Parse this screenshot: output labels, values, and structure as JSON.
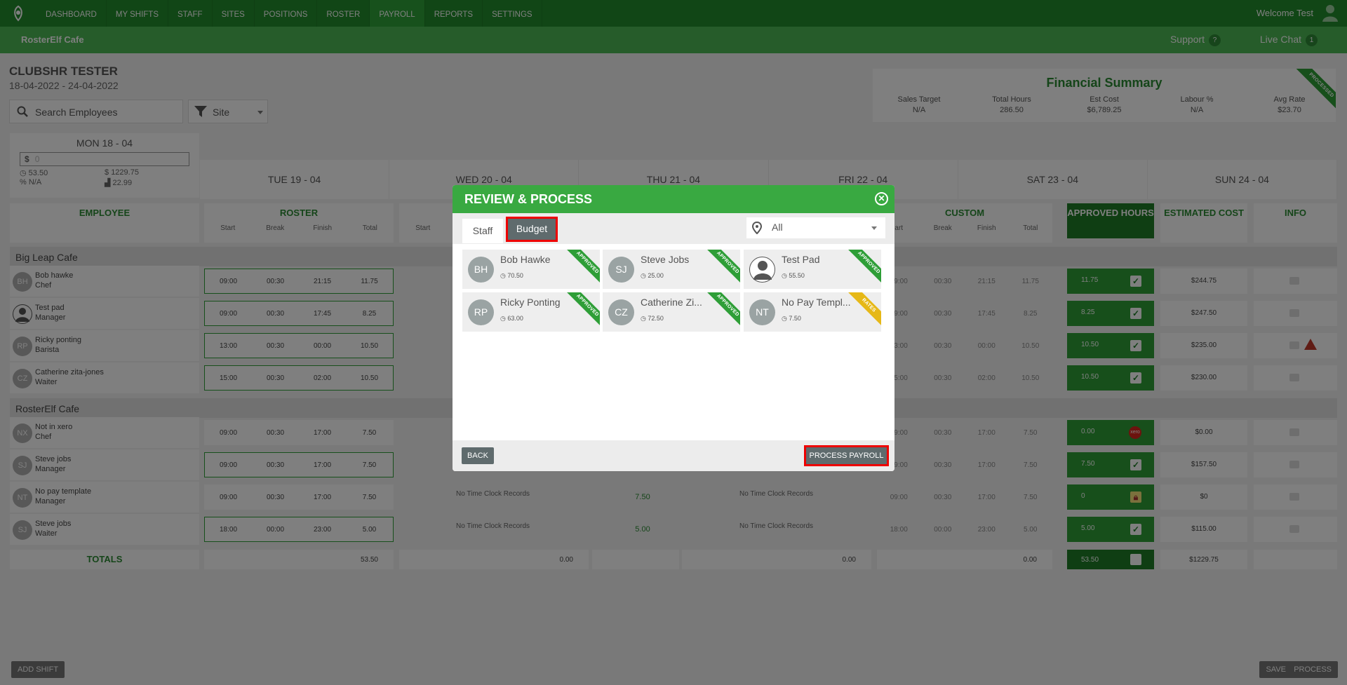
{
  "nav": {
    "items": [
      {
        "label": "DASHBOARD"
      },
      {
        "label": "MY SHIFTS"
      },
      {
        "label": "STAFF"
      },
      {
        "label": "SITES"
      },
      {
        "label": "POSITIONS"
      },
      {
        "label": "ROSTER"
      },
      {
        "label": "PAYROLL"
      },
      {
        "label": "REPORTS"
      },
      {
        "label": "SETTINGS"
      }
    ],
    "active": "PAYROLL",
    "welcome": "Welcome Test"
  },
  "subbar": {
    "cafe_name": "RosterElf Cafe",
    "support": "Support",
    "support_badge": "?",
    "live_chat": "Live Chat",
    "live_chat_badge": "1"
  },
  "page": {
    "title": "CLUBSHR TESTER",
    "dates": "18-04-2022 - 24-04-2022",
    "search_placeholder": "Search Employees",
    "site_filter": "Site"
  },
  "financial_summary": {
    "title": "Financial Summary",
    "ribbon": "PROCESSED",
    "cols": [
      {
        "label": "Sales Target",
        "value": "N/A"
      },
      {
        "label": "Total Hours",
        "value": "286.50"
      },
      {
        "label": "Est Cost",
        "value": "$6,789.25"
      },
      {
        "label": "Labour %",
        "value": "N/A"
      },
      {
        "label": "Avg Rate",
        "value": "$23.70"
      }
    ]
  },
  "monday": {
    "title": "MON 18 - 04",
    "currency": "$",
    "input_value": "0",
    "hours": "53.50",
    "cost": "1229.75",
    "pct": "N/A",
    "rate": "22.99"
  },
  "days": [
    "TUE 19 - 04",
    "WED 20 - 04",
    "THU 21 - 04",
    "FRI 22 - 04",
    "SAT 23 - 04",
    "SUN 24 - 04"
  ],
  "headers": {
    "employee": "EMPLOYEE",
    "roster": "ROSTER",
    "custom": "CUSTOM",
    "approved": "APPROVED HOURS",
    "estimated": "ESTIMATED COST",
    "info": "INFO",
    "start": "Start",
    "break": "Break",
    "finish": "Finish",
    "total": "Total",
    "start_trunc": "art"
  },
  "sections": [
    "Big Leap Cafe",
    "RosterElf Cafe"
  ],
  "rows": [
    {
      "initials": "BH",
      "name": "Bob hawke",
      "role": "Chef",
      "start": "09:00",
      "break": "00:30",
      "finish": "21:15",
      "total": "11.75",
      "approved": "11.75",
      "est": "$244.75"
    },
    {
      "initials": "",
      "name": "Test pad",
      "role": "Manager",
      "start": "09:00",
      "break": "00:30",
      "finish": "17:45",
      "total": "8.25",
      "approved": "8.25",
      "est": "$247.50"
    },
    {
      "initials": "RP",
      "name": "Ricky ponting",
      "role": "Barista",
      "start": "13:00",
      "break": "00:30",
      "finish": "00:00",
      "total": "10.50",
      "approved": "10.50",
      "est": "$235.00"
    },
    {
      "initials": "CZ",
      "name": "Catherine zita-jones",
      "role": "Waiter",
      "start": "15:00",
      "break": "00:30",
      "finish": "02:00",
      "total": "10.50",
      "approved": "10.50",
      "est": "$230.00"
    },
    {
      "initials": "NX",
      "name": "Not in xero",
      "role": "Chef",
      "start": "09:00",
      "break": "00:30",
      "finish": "17:00",
      "total": "7.50",
      "approved": "0.00",
      "est": "$0.00",
      "xero_label": "xero"
    },
    {
      "initials": "SJ",
      "name": "Steve jobs",
      "role": "Manager",
      "start": "09:00",
      "break": "00:30",
      "finish": "17:00",
      "total": "7.50",
      "approved": "7.50",
      "est": "$157.50"
    },
    {
      "initials": "NT",
      "name": "No pay template",
      "role": "Manager",
      "start": "09:00",
      "break": "00:30",
      "finish": "17:00",
      "total": "7.50",
      "approved": "0",
      "est": "$0",
      "no_tc": "No Time Clock Records",
      "mid": "7.50"
    },
    {
      "initials": "SJ",
      "name": "Steve jobs",
      "role": "Waiter",
      "start": "18:00",
      "break": "00:00",
      "finish": "23:00",
      "total": "5.00",
      "approved": "5.00",
      "est": "$115.00",
      "no_tc": "No Time Clock Records",
      "mid": "5.00"
    }
  ],
  "totals": {
    "label": "TOTALS",
    "roster": "53.50",
    "wed": "0.00",
    "fri": "0.00",
    "custom": "0.00",
    "approved": "53.50",
    "est": "$1229.75"
  },
  "bottom": {
    "add_shift": "ADD SHIFT",
    "save": "SAVE",
    "process": "PROCESS"
  },
  "modal": {
    "title": "REVIEW & PROCESS",
    "tabs": {
      "staff": "Staff",
      "budget": "Budget"
    },
    "filter": "All",
    "cards": [
      {
        "initials": "BH",
        "name": "Bob Hawke",
        "hours": "70.50",
        "status": "APPROVED"
      },
      {
        "initials": "SJ",
        "name": "Steve Jobs",
        "hours": "25.00",
        "status": "APPROVED"
      },
      {
        "initials": "",
        "name": "Test Pad",
        "hours": "55.50",
        "status": "APPROVED"
      },
      {
        "initials": "RP",
        "name": "Ricky Ponting",
        "hours": "63.00",
        "status": "APPROVED"
      },
      {
        "initials": "CZ",
        "name": "Catherine Zi...",
        "hours": "72.50",
        "status": "APPROVED"
      },
      {
        "initials": "NT",
        "name": "No Pay Templ...",
        "hours": "7.50",
        "status": "RATES"
      }
    ],
    "back": "BACK",
    "process_payroll": "PROCESS PAYROLL"
  },
  "colors": {
    "nav": "#238d2c",
    "subbar": "#4cb954",
    "accent": "#39a941",
    "highlight": "#ee0000",
    "rates": "#e6b817"
  }
}
